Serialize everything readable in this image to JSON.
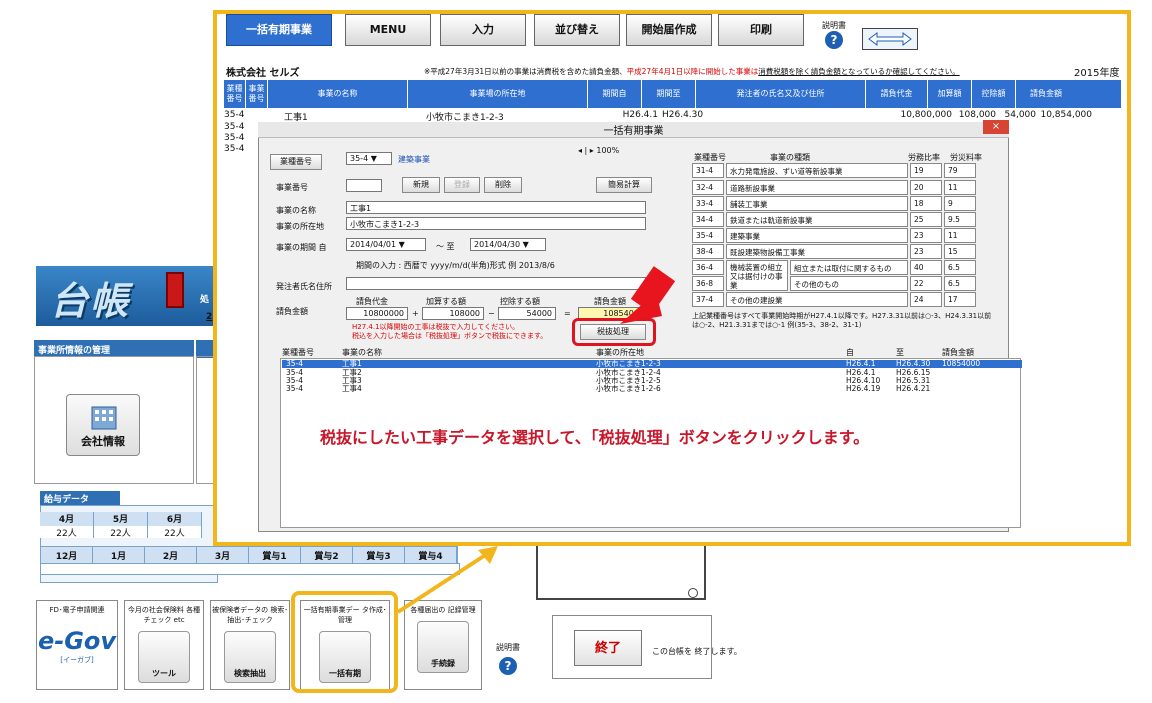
{
  "main": {
    "side_title": "処",
    "side_num": "2",
    "office_header": "事業所情報の管理",
    "company_btn": "会社情報",
    "payroll_tab": "給与データ",
    "months1": [
      "4月",
      "5月",
      "6月"
    ],
    "counts1": [
      "22人",
      "22人",
      "22人"
    ],
    "months2": [
      "12月",
      "1月",
      "2月",
      "3月",
      "賞与1",
      "賞与2",
      "賞与3",
      "賞与4"
    ],
    "tools": [
      {
        "title": "FD･電子申請関連",
        "label": "e-Gov",
        "sub": "[イーガブ]"
      },
      {
        "title": "今月の社会保険料 各種チェック etc",
        "label": "ツール"
      },
      {
        "title": "被保険者データの 検索･抽出･チェック",
        "label": "検索抽出"
      },
      {
        "title": "一括有期事業デー タ作成･管理",
        "label": "一括有期"
      },
      {
        "title": "各種届出の 記録管理",
        "label": "手続録"
      }
    ],
    "manual_label": "説明書",
    "end_label": "終了",
    "end_text": "この台帳を 終了します。"
  },
  "toolbar": {
    "tabs": [
      "一括有期事業",
      "MENU",
      "入力",
      "並び替え",
      "開始届作成",
      "印刷"
    ],
    "manual_label": "説明書",
    "company": "株式会社 セルズ",
    "note_pre": "※平成27年3月31日以前の事業は消費税を含めた請負金額、",
    "note_red": "平成27年4月1日以降に開始した事業は",
    "note_post": "消費税額を除く請負金額となっているか確認してください。",
    "year": "2015年度"
  },
  "grid": {
    "headers": [
      "業種 番号",
      "事業 番号",
      "事業の名称",
      "事業場の所在地",
      "期間自",
      "期間至",
      "発注者の氏名又及び住所",
      "請負代金",
      "加算額",
      "控除額",
      "請負金額"
    ],
    "row1": [
      "35-4",
      "工事1",
      "小牧市こまき1-2-3",
      "H26.4.1",
      "H26.4.30",
      "10,800,000",
      "108,000",
      "54,000",
      "10,854,000"
    ],
    "other_codes": [
      "35-4",
      "35-4",
      "35-4"
    ]
  },
  "dialog": {
    "title": "一括有期事業",
    "close": "×",
    "type_label": "業種番号",
    "type_value": "35-4",
    "type_name": "建築事業",
    "zoom": "100%",
    "jigyo_label": "事業番号",
    "new_btn": "新規",
    "reg_btn": "登録",
    "del_btn": "削除",
    "calc_btn": "簡易計算",
    "name_label": "事業の名称",
    "name_value": "工事1",
    "addr_label": "事業の所在地",
    "addr_value": "小牧市こまき1-2-3",
    "period_label": "事業の期間 自",
    "from": "2014/04/01",
    "tilde": "～ 至",
    "to": "2014/04/30",
    "period_hint": "期間の入力 : 西暦で yyyy/m/d(半角)形式 例 2013/8/6",
    "client_label": "発注者氏名住所",
    "amount_label": "請負金額",
    "col_a": "請負代金",
    "col_b": "加算する額",
    "col_c": "控除する額",
    "col_d": "請負金額",
    "val_a": "10800000",
    "val_b": "108000",
    "val_c": "54000",
    "val_d": "10854000",
    "op_plus": "+",
    "op_minus": "−",
    "op_eq": "=",
    "warn1": "H27.4.1以降開始の工事は税抜で入力してください。",
    "warn2": "税込を入力した場合は「税抜処理」ボタンで税抜にできます。",
    "tax_btn": "税抜処理",
    "tbl_h1": "業種番号",
    "tbl_h2": "事業の種類",
    "tbl_h3": "労務比率",
    "tbl_h4": "労災料率",
    "types": [
      [
        "31-4",
        "水力発電施設、ずい道等新設事業",
        "19",
        "79"
      ],
      [
        "32-4",
        "道路新設事業",
        "20",
        "11"
      ],
      [
        "33-4",
        "舗装工事業",
        "18",
        "9"
      ],
      [
        "34-4",
        "鉄道または軌道新設事業",
        "25",
        "9.5"
      ],
      [
        "35-4",
        "建築事業",
        "23",
        "11"
      ],
      [
        "38-4",
        "既設建築物設備工事業",
        "23",
        "15"
      ],
      [
        "36-4",
        "機械装置の組立又は据付けの事業",
        "組立または取付に関するもの",
        "40",
        "6.5"
      ],
      [
        "36-8",
        "",
        "その他のもの",
        "22",
        "6.5"
      ],
      [
        "37-4",
        "その他の建設業",
        "24",
        "17"
      ]
    ],
    "tbl_note": "上記業種番号はすべて事業開始時期がH27.4.1以降です。H27.3.31以前は○-3、H24.3.31以前は○-2、H21.3.31までは○-1 例(35-3、38-2、31-1)",
    "list_h": [
      "業種番号",
      "事業の名称",
      "事業の所在地",
      "自",
      "至",
      "請負金額"
    ],
    "list": [
      [
        "35-4",
        "工事1",
        "小牧市こまき1-2-3",
        "H26.4.1",
        "H26.4.30",
        "10854000"
      ],
      [
        "35-4",
        "工事2",
        "小牧市こまき1-2-4",
        "H26.4.1",
        "H26.6.15",
        ""
      ],
      [
        "35-4",
        "工事3",
        "小牧市こまき1-2-5",
        "H26.4.10",
        "H26.5.31",
        ""
      ],
      [
        "35-4",
        "工事4",
        "小牧市こまき1-2-6",
        "H26.4.19",
        "H26.4.21",
        ""
      ]
    ]
  },
  "instruction": "税抜にしたい工事データを選択して、「税抜処理」ボタンをクリックします。",
  "colors": {
    "accent": "#f2b61c",
    "blue": "#2f6fcf",
    "red": "#e0141e"
  }
}
